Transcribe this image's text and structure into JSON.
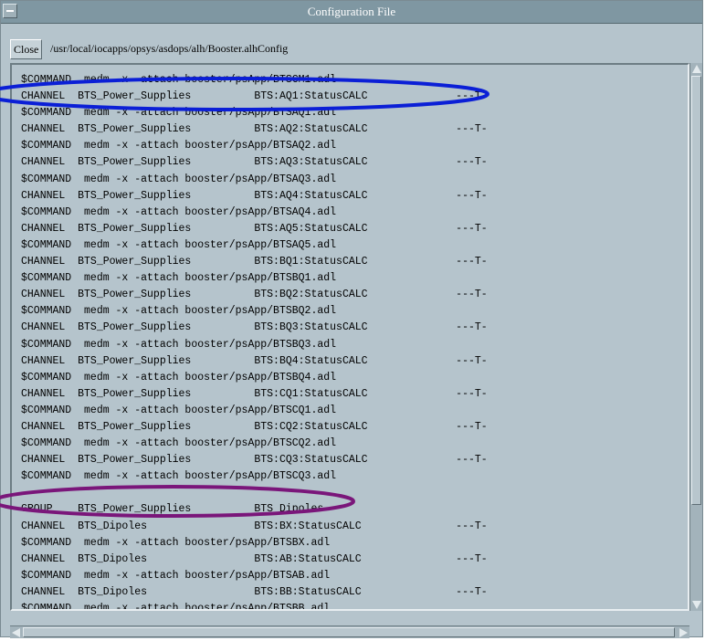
{
  "window": {
    "title": "Configuration File",
    "close_label": "Close",
    "path": "/usr/local/iocapps/opsys/asdops/alh/Booster.alhConfig"
  },
  "lines": [
    "$COMMAND  medm -x -attach booster/psApp/BTSCM1.adl",
    "CHANNEL  BTS_Power_Supplies          BTS:AQ1:StatusCALC              ---T-",
    "$COMMAND  medm -x -attach booster/psApp/BTSAQ1.adl",
    "CHANNEL  BTS_Power_Supplies          BTS:AQ2:StatusCALC              ---T-",
    "$COMMAND  medm -x -attach booster/psApp/BTSAQ2.adl",
    "CHANNEL  BTS_Power_Supplies          BTS:AQ3:StatusCALC              ---T-",
    "$COMMAND  medm -x -attach booster/psApp/BTSAQ3.adl",
    "CHANNEL  BTS_Power_Supplies          BTS:AQ4:StatusCALC              ---T-",
    "$COMMAND  medm -x -attach booster/psApp/BTSAQ4.adl",
    "CHANNEL  BTS_Power_Supplies          BTS:AQ5:StatusCALC              ---T-",
    "$COMMAND  medm -x -attach booster/psApp/BTSAQ5.adl",
    "CHANNEL  BTS_Power_Supplies          BTS:BQ1:StatusCALC              ---T-",
    "$COMMAND  medm -x -attach booster/psApp/BTSBQ1.adl",
    "CHANNEL  BTS_Power_Supplies          BTS:BQ2:StatusCALC              ---T-",
    "$COMMAND  medm -x -attach booster/psApp/BTSBQ2.adl",
    "CHANNEL  BTS_Power_Supplies          BTS:BQ3:StatusCALC              ---T-",
    "$COMMAND  medm -x -attach booster/psApp/BTSBQ3.adl",
    "CHANNEL  BTS_Power_Supplies          BTS:BQ4:StatusCALC              ---T-",
    "$COMMAND  medm -x -attach booster/psApp/BTSBQ4.adl",
    "CHANNEL  BTS_Power_Supplies          BTS:CQ1:StatusCALC              ---T-",
    "$COMMAND  medm -x -attach booster/psApp/BTSCQ1.adl",
    "CHANNEL  BTS_Power_Supplies          BTS:CQ2:StatusCALC              ---T-",
    "$COMMAND  medm -x -attach booster/psApp/BTSCQ2.adl",
    "CHANNEL  BTS_Power_Supplies          BTS:CQ3:StatusCALC              ---T-",
    "$COMMAND  medm -x -attach booster/psApp/BTSCQ3.adl",
    "",
    "GROUP    BTS_Power_Supplies          BTS_Dipoles",
    "CHANNEL  BTS_Dipoles                 BTS:BX:StatusCALC               ---T-",
    "$COMMAND  medm -x -attach booster/psApp/BTSBX.adl",
    "CHANNEL  BTS_Dipoles                 BTS:AB:StatusCALC               ---T-",
    "$COMMAND  medm -x -attach booster/psApp/BTSAB.adl",
    "CHANNEL  BTS_Dipoles                 BTS:BB:StatusCALC               ---T-",
    "$COMMAND  medm -x -attach booster/psApp/BTSBB.adl"
  ],
  "annotations": {
    "blue_color": "#0b1fd6",
    "purple_color": "#7a167a"
  },
  "colors": {
    "window_bg": "#b5c4cc",
    "titlebar_bg": "#7f97a2"
  }
}
